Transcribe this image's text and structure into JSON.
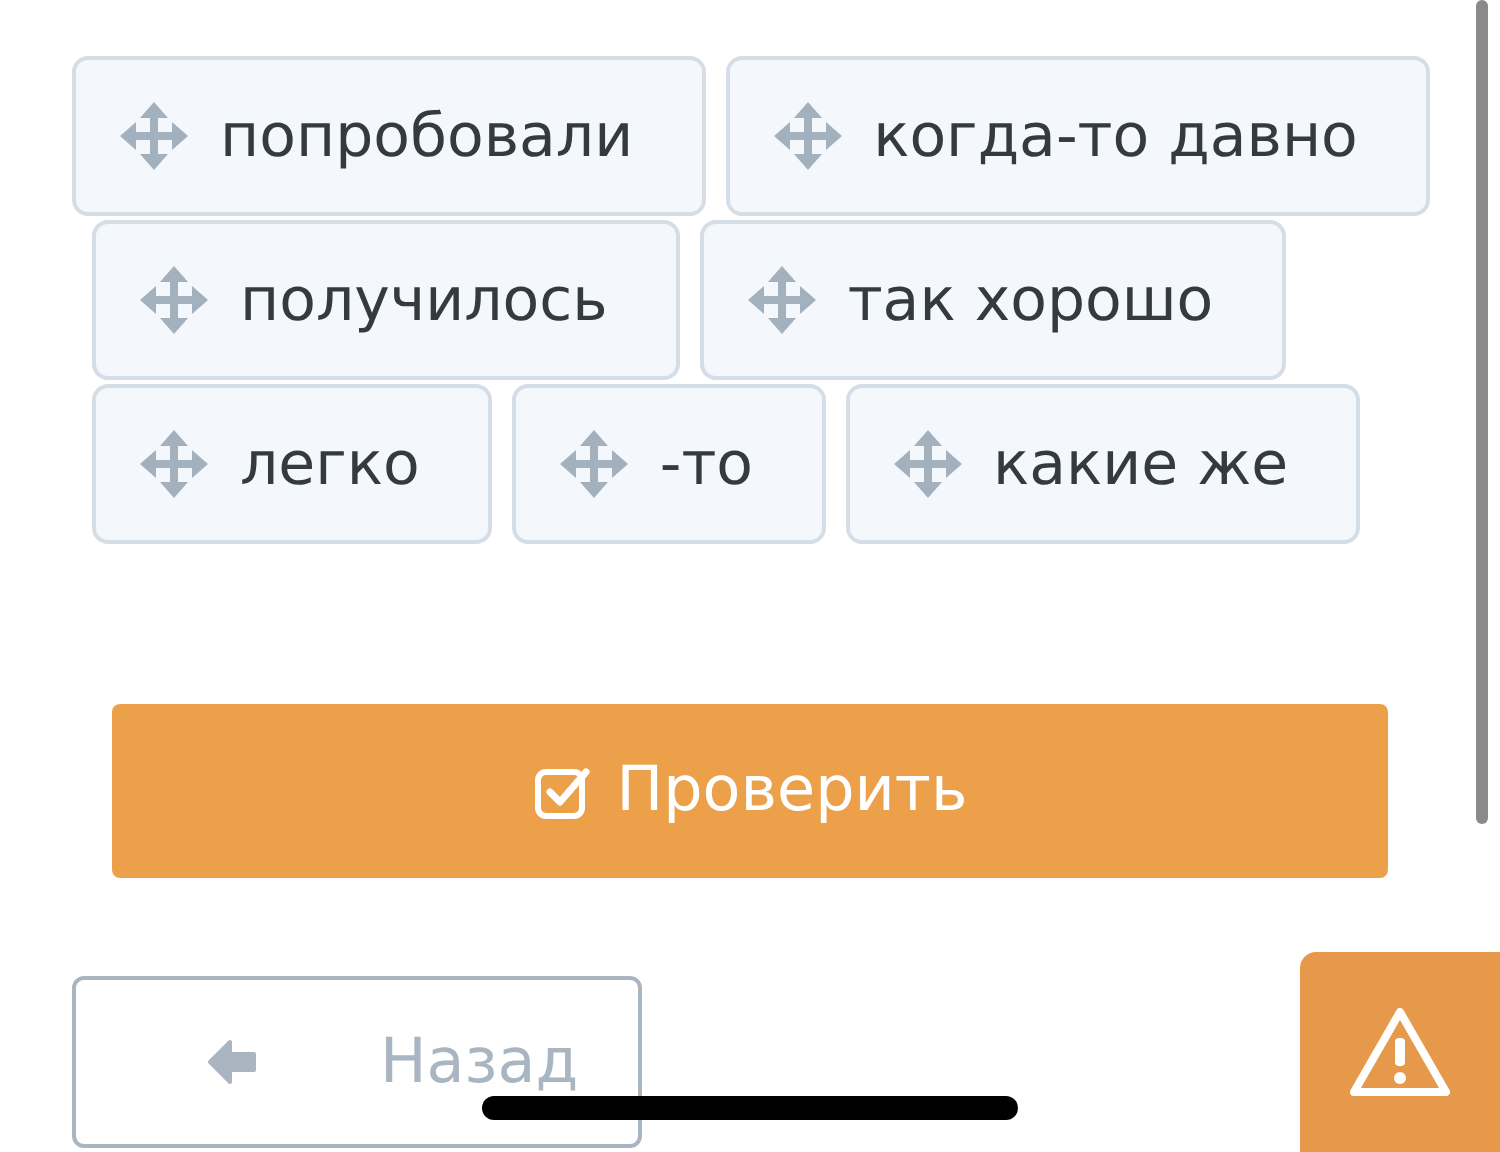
{
  "word_rows": [
    [
      "попробовали",
      "когда-то давно"
    ],
    [
      "получилось",
      "так хорошо"
    ],
    [
      "легко",
      "-то",
      "какие же"
    ]
  ],
  "check_button": {
    "label": "Проверить"
  },
  "back_button": {
    "label": "Назад"
  }
}
